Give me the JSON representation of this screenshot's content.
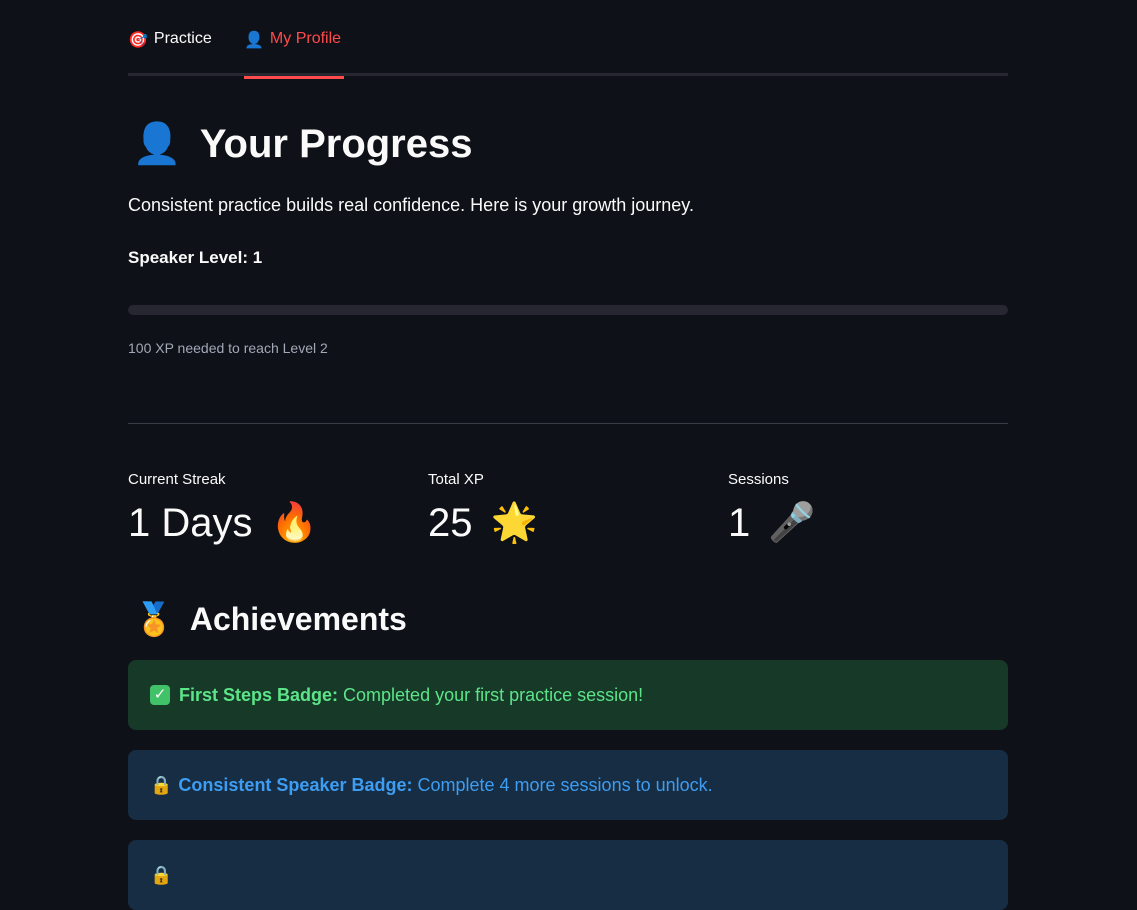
{
  "tabs": [
    {
      "icon": "🎯",
      "label": "Practice"
    },
    {
      "icon": "👤",
      "label": "My Profile"
    }
  ],
  "page": {
    "title_icon": "👤",
    "title": "Your Progress",
    "subtitle": "Consistent practice builds real confidence. Here is your growth journey.",
    "level_label": "Speaker Level: 1",
    "progress_fraction": 0,
    "caption": "100 XP needed to reach Level 2"
  },
  "metrics": [
    {
      "label": "Current Streak",
      "value": "1 Days",
      "icon": "🔥"
    },
    {
      "label": "Total XP",
      "value": "25",
      "icon": "🌟"
    },
    {
      "label": "Sessions",
      "value": "1",
      "icon": "🎤"
    }
  ],
  "achievements": {
    "icon": "🏅",
    "title": "Achievements",
    "items": [
      {
        "icon": "✓",
        "name": "First Steps Badge:",
        "text": "Completed your first practice session!"
      },
      {
        "icon": "🔒",
        "name": "Consistent Speaker Badge:",
        "text": "Complete 4 more sessions to unlock."
      },
      {
        "icon": "🔒",
        "name": "",
        "text": ""
      }
    ]
  },
  "colors": {
    "background": "#0e1117",
    "accent": "#ff4b4b",
    "success_bg": "#173928",
    "success_text": "#5ce488",
    "info_bg": "#172d43",
    "info_text": "#3d9df3"
  }
}
